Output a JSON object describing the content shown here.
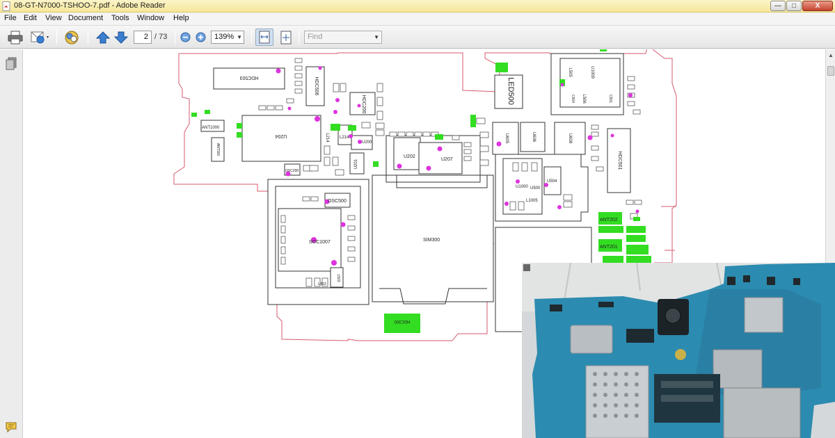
{
  "window": {
    "title": "08-GT-N7000-TSHOO-7.pdf - Adobe Reader",
    "min_label": "—",
    "max_label": "□",
    "close_label": "X"
  },
  "menu": [
    "File",
    "Edit",
    "View",
    "Document",
    "Tools",
    "Window",
    "Help"
  ],
  "toolbar": {
    "page_current": "2",
    "page_total": "/ 73",
    "zoom": "139%",
    "find_placeholder": "Find",
    "icons": [
      "print-icon",
      "email-icon",
      "collaborate-icon",
      "previous-page-icon",
      "next-page-icon",
      "zoom-out-icon",
      "zoom-in-icon",
      "fit-width-icon",
      "fit-page-icon"
    ]
  },
  "sidebar": {
    "icons": [
      "pages-panel-icon",
      "comments-icon"
    ]
  },
  "schematic_labels": {
    "hdc503": "HDC503",
    "hdc506": "HDC506",
    "hdc200": "HDC200",
    "led500": "LED500",
    "l505": "L505",
    "u_top": "U1009",
    "l506": "L506",
    "c504": "C504",
    "c501": "C501",
    "ant1000": "ANT1000",
    "ant300": "ANT300",
    "u204": "U204",
    "l214": "L214",
    "u200": "U200",
    "u201": "U201",
    "u202": "U202",
    "u207": "U207",
    "u605": "U605",
    "u606": "U606",
    "u608": "U608",
    "hdc501": "HDC501",
    "osc200": "OSC200",
    "osc500": "OSC500",
    "u1000": "U1000",
    "u504": "U504",
    "l1005": "L1005",
    "u500_label": "U500",
    "sim300": "SIM300",
    "soc1007": "SOC1007",
    "ant202": "ANT202",
    "ant201": "ANT201",
    "hdc300": "HDC300",
    "u502": "U502",
    "l503": "L503"
  },
  "colors": {
    "outline": "#d65a6e",
    "highlight_green": "#33dd22",
    "marker_magenta": "#dd33dd",
    "pcb_blue": "#2c8bb0"
  }
}
